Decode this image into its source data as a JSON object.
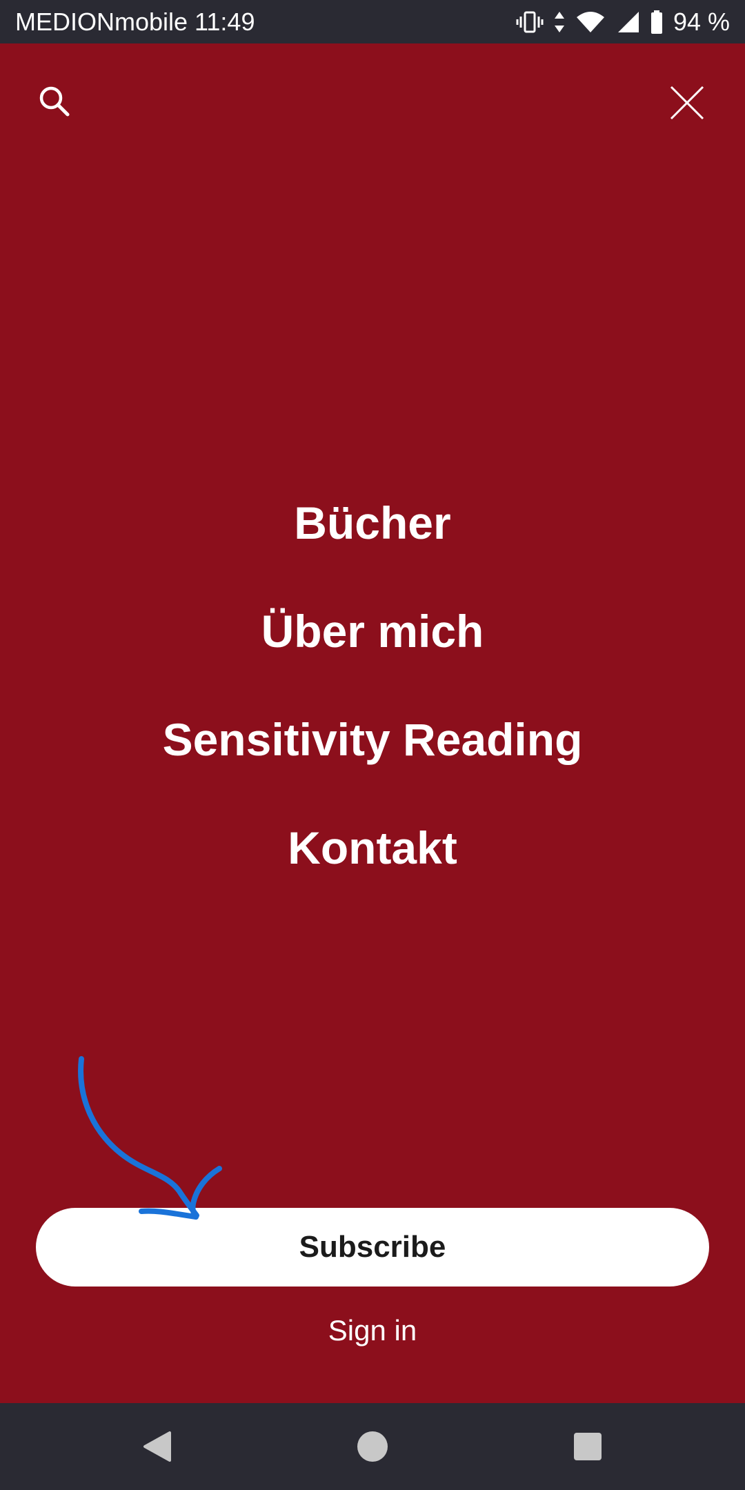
{
  "status_bar": {
    "carrier_time": "MEDIONmobile 11:49",
    "battery": "94 %",
    "icons": [
      "vibrate-icon",
      "data-arrows-icon",
      "wifi-icon",
      "signal-icon",
      "battery-icon"
    ]
  },
  "header": {
    "search_icon": "search-icon",
    "close_icon": "close-icon"
  },
  "menu": {
    "items": [
      {
        "label": "Bücher"
      },
      {
        "label": "Über mich"
      },
      {
        "label": "Sensitivity Reading"
      },
      {
        "label": "Kontakt"
      }
    ]
  },
  "actions": {
    "subscribe_label": "Subscribe",
    "signin_label": "Sign in"
  },
  "nav_bar": {
    "icons": [
      "back-icon",
      "home-icon",
      "recents-icon"
    ]
  },
  "colors": {
    "background": "#8c0f1c",
    "system_bars": "#2a2a33",
    "button_bg": "#ffffff",
    "annotation": "#1a73d9"
  }
}
